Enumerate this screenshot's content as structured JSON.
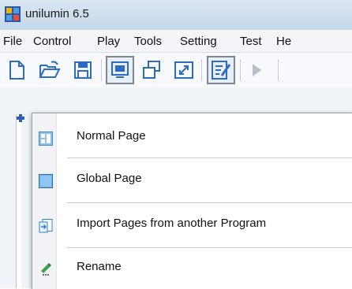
{
  "window": {
    "title": "unilumin 6.5"
  },
  "menubar": {
    "items": [
      {
        "label": "File"
      },
      {
        "label": "Control"
      },
      {
        "label": "Play"
      },
      {
        "label": "Tools"
      },
      {
        "label": "Setting"
      },
      {
        "label": "Test"
      },
      {
        "label": "He"
      }
    ]
  },
  "toolbar": {
    "buttons": [
      {
        "icon": "new-document-icon"
      },
      {
        "icon": "open-folder-icon"
      },
      {
        "icon": "save-icon"
      },
      {
        "icon": "screen-display-icon",
        "pressed": true
      },
      {
        "icon": "cascade-windows-icon"
      },
      {
        "icon": "fullscreen-icon"
      },
      {
        "icon": "edit-icon",
        "pressed": true
      },
      {
        "icon": "play-icon"
      }
    ]
  },
  "context_menu": {
    "items": [
      {
        "label": "Normal Page",
        "icon": "normal-page-icon"
      },
      {
        "label": "Global Page",
        "icon": "global-page-icon"
      },
      {
        "label": "Import Pages from another Program",
        "icon": "import-pages-icon"
      },
      {
        "label": "Rename",
        "icon": "rename-icon"
      }
    ]
  },
  "colors": {
    "accent": "#2b6cc4",
    "titlebar": "#c6d6ea",
    "menu_border": "#97a0ad"
  }
}
